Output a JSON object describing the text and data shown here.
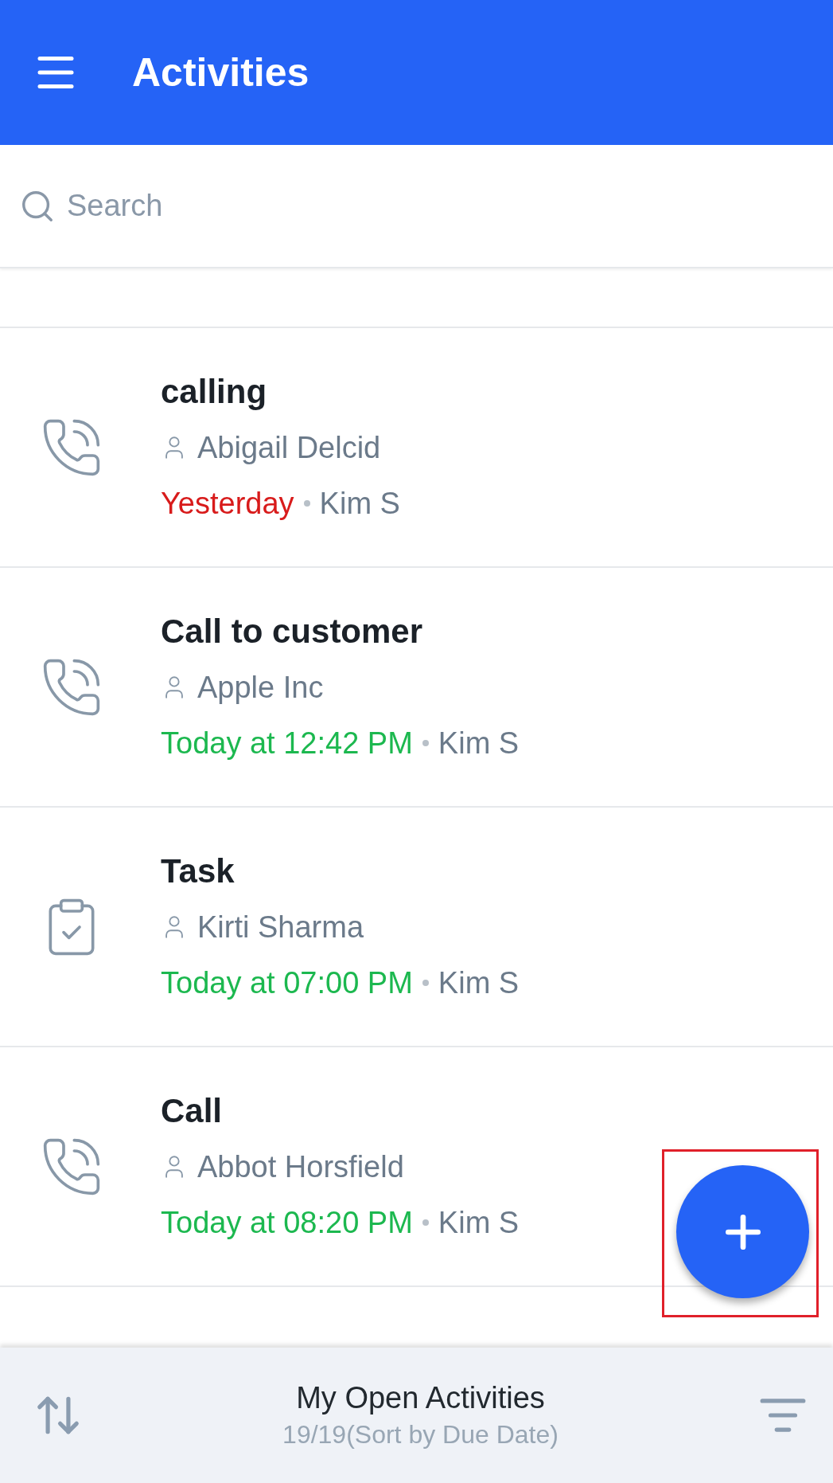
{
  "header": {
    "title": "Activities"
  },
  "search": {
    "placeholder": "Search"
  },
  "activities": [
    {
      "kind": "call",
      "title": "calling",
      "contact": "Abigail Delcid",
      "due": "Yesterday",
      "overdue": true,
      "owner": "Kim S"
    },
    {
      "kind": "call",
      "title": "Call to customer",
      "contact": "Apple Inc",
      "due": "Today at 12:42 PM",
      "overdue": false,
      "owner": "Kim S"
    },
    {
      "kind": "task",
      "title": "Task",
      "contact": "Kirti Sharma",
      "due": "Today at 07:00 PM",
      "overdue": false,
      "owner": "Kim S"
    },
    {
      "kind": "call",
      "title": "Call",
      "contact": "Abbot Horsfield",
      "due": "Today at 08:20 PM",
      "overdue": false,
      "owner": "Kim S"
    }
  ],
  "fab": {
    "highlighted": true
  },
  "bottom_bar": {
    "title": "My Open Activities",
    "subtitle": "19/19(Sort by Due Date)"
  }
}
